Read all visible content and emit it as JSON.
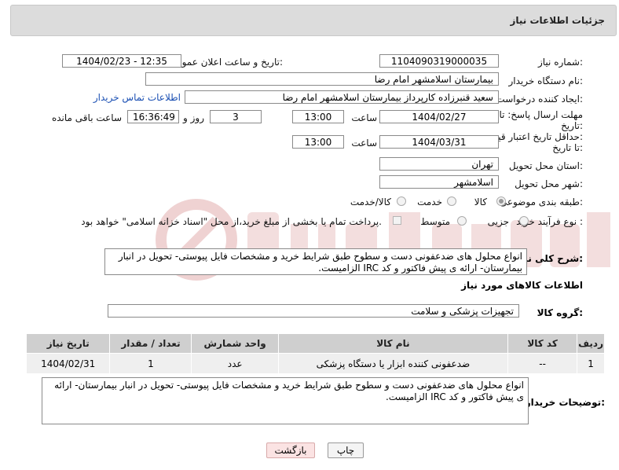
{
  "header": {
    "title": "جزئیات اطلاعات نیاز"
  },
  "fields": {
    "need_number": {
      "label": "شماره نیاز:",
      "value": "1104090319000035"
    },
    "announce_datetime": {
      "label": "تاریخ و ساعت اعلان عمومی:",
      "value": "1404/02/23 - 12:35"
    },
    "buyer_org": {
      "label": "نام دستگاه خریدار:",
      "value": "بیمارستان اسلامشهر   امام رضا"
    },
    "requester": {
      "label": "ایجاد کننده درخواست:",
      "value": "سعید قنبرزاده کارپرداز بیمارستان اسلامشهر   امام رضا",
      "link": "اطلاعات تماس خریدار"
    },
    "reply_deadline": {
      "label_line1": "مهلت ارسال پاسخ: تا",
      "label_line2": "تاریخ:",
      "date": "1404/02/27",
      "time_label": "ساعت",
      "time": "13:00",
      "days": "3",
      "days_label": "روز و",
      "remaining_time": "16:36:49",
      "remaining_label": "ساعت باقی مانده"
    },
    "price_validity": {
      "label_line1": "حداقل تاریخ اعتبار قیمت:",
      "label_line2": "تا تاریخ:",
      "date": "1404/03/31",
      "time_label": "ساعت",
      "time": "13:00"
    },
    "province": {
      "label": "استان محل تحویل:",
      "value": "تهران"
    },
    "city": {
      "label": "شهر محل تحویل:",
      "value": "اسلامشهر"
    },
    "category": {
      "label": "طبقه بندی موضوعی:",
      "options": [
        "کالا",
        "خدمت",
        "کالا/خدمت"
      ],
      "selected": "کالا"
    },
    "process_type": {
      "label": "نوع فرآیند خرید :",
      "options": [
        "جزیی",
        "متوسط"
      ],
      "selected": "",
      "note": "پرداخت تمام یا بخشی از مبلغ خرید،از محل \"اسناد خزانه اسلامی\" خواهد بود."
    }
  },
  "summary": {
    "label": "شرح کلی نیاز:",
    "text": "انواع محلول های ضدعفونی دست و سطوح طبق شرایط خرید و مشخصات فایل پیوستی- تحویل در انبار بیمارستان- ارائه ی پیش فاکتور و کد IRC الزامیست."
  },
  "goods_info": {
    "title": "اطلاعات کالاهای مورد نیاز"
  },
  "goods_group": {
    "label": "گروه کالا:",
    "value": "تجهیزات پزشکی و سلامت"
  },
  "table": {
    "headers": [
      "ردیف",
      "کد کالا",
      "نام کالا",
      "واحد شمارش",
      "تعداد / مقدار",
      "تاریخ نیاز"
    ],
    "rows": [
      [
        "1",
        "--",
        "ضدعفونی کننده ابزار یا دستگاه پزشکی",
        "عدد",
        "1",
        "1404/02/31"
      ]
    ]
  },
  "buyer_notes": {
    "label": "توضیحات خریدار:",
    "text": "انواع محلول های ضدعفونی دست و سطوح طبق شرایط خرید و مشخصات فایل پیوستی- تحویل در انبار بیمارستان- ارائه ی پیش فاکتور و کد IRC الزامیست."
  },
  "buttons": {
    "print": "چاپ",
    "back": "بازگشت"
  },
  "colors": {
    "link": "#1a4fb3",
    "header_bg": "#dcdcdc",
    "watermark": "#e8c4c4"
  }
}
